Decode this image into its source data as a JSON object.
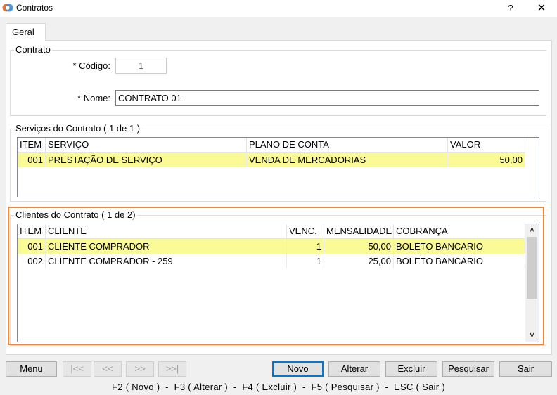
{
  "window": {
    "title": "Contratos",
    "help_label": "?",
    "close_label": "✕"
  },
  "tabs": [
    {
      "label": "Geral"
    }
  ],
  "contrato": {
    "legend": "Contrato",
    "codigo_label": "* Código:",
    "codigo_value": "1",
    "nome_label": "* Nome:",
    "nome_value": "CONTRATO 01"
  },
  "servicos": {
    "legend": "Serviços do Contrato ( 1 de 1 )",
    "columns": [
      "ITEM",
      "SERVIÇO",
      "PLANO DE CONTA",
      "VALOR"
    ],
    "rows": [
      {
        "item": "001",
        "servico": "PRESTAÇÃO DE SERVIÇO",
        "plano": "VENDA DE MERCADORIAS",
        "valor": "50,00"
      }
    ]
  },
  "clientes": {
    "legend": "Clientes do Contrato ( 1 de 2)",
    "columns": [
      "ITEM",
      "CLIENTE",
      "VENC.",
      "MENSALIDADE",
      "COBRANÇA"
    ],
    "rows": [
      {
        "item": "001",
        "cliente": "CLIENTE COMPRADOR",
        "venc": "1",
        "mensalidade": "50,00",
        "cobranca": "BOLETO BANCARIO"
      },
      {
        "item": "002",
        "cliente": "CLIENTE COMPRADOR - 259",
        "venc": "1",
        "mensalidade": "25,00",
        "cobranca": "BOLETO BANCARIO"
      }
    ],
    "scroll_up": "˄",
    "scroll_down": "˅"
  },
  "buttons": {
    "menu": "Menu",
    "first": "|<<",
    "prev": "<<",
    "next": ">>",
    "last": ">>|",
    "novo": "Novo",
    "alterar": "Alterar",
    "excluir": "Excluir",
    "pesquisar": "Pesquisar",
    "sair": "Sair"
  },
  "shortcuts_text": "F2 ( Novo )  -  F3 ( Alterar )  -  F4 ( Excluir )  -  F5 ( Pesquisar )  -  ESC ( Sair )",
  "colors": {
    "highlight": "#fafa96",
    "focus_frame": "#f0883c",
    "default_button_border": "#0078d7"
  }
}
